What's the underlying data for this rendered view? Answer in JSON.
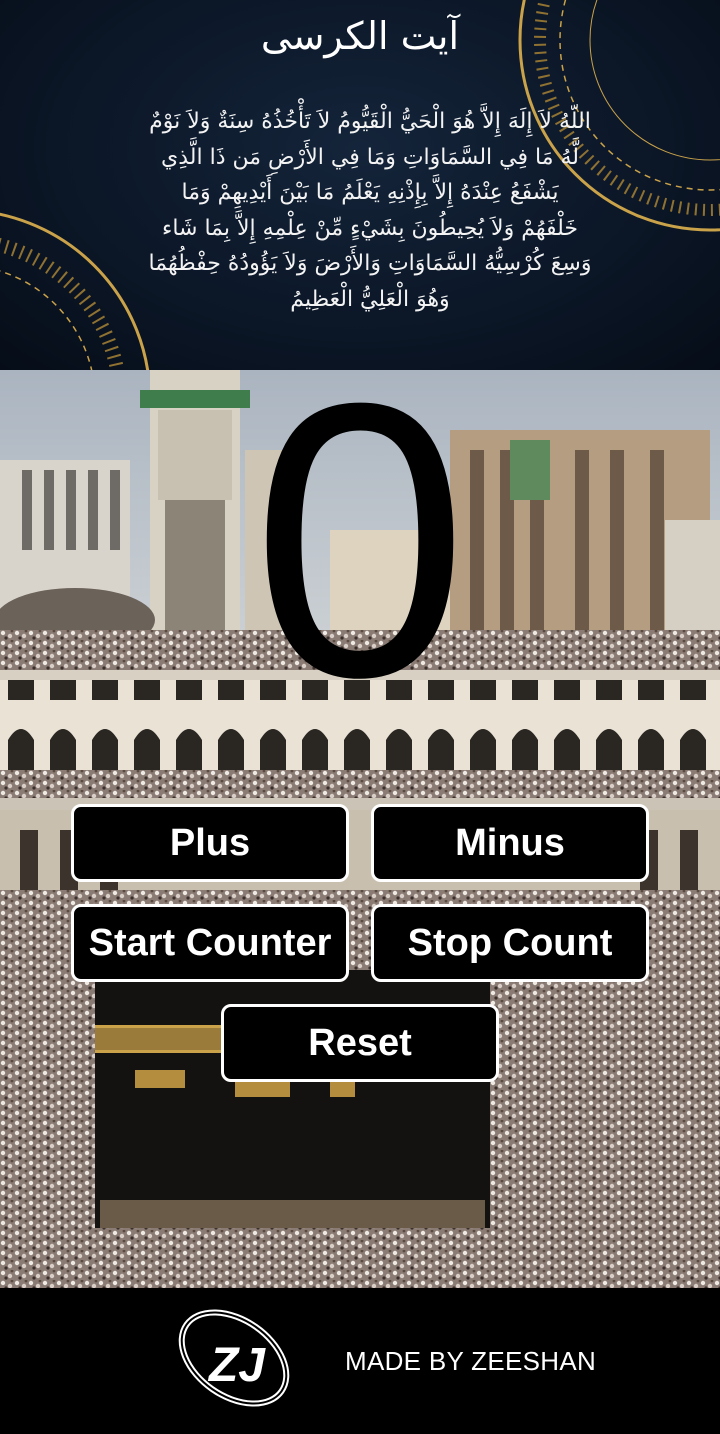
{
  "header": {
    "title": "آیت الکرسی",
    "ayat_lines": [
      "اللّهُ لاَ إِلَهَ إِلاَّ هُوَ الْحَيُّ الْقَيُّومُ لاَ تَأْخُذُهُ سِنَةٌ وَلاَ نَوْمٌ",
      "لَّهُ مَا فِي السَّمَاوَاتِ وَمَا فِي الأَرْضِ مَن ذَا الَّذِي",
      "يَشْفَعُ عِنْدَهُ إِلاَّ بِإِذْنِهِ يَعْلَمُ مَا بَيْنَ أَيْدِيهِمْ وَمَا",
      "خَلْفَهُمْ وَلاَ يُحِيطُونَ بِشَيْءٍ مِّنْ عِلْمِهِ إِلاَّ بِمَا شَاء",
      "وَسِعَ كُرْسِيُّهُ السَّمَاوَاتِ وَالأَرْضَ وَلاَ يَؤُودُهُ حِفْظُهُمَا",
      "وَهُوَ الْعَلِيُّ الْعَظِيمُ"
    ]
  },
  "counter": {
    "value": "0"
  },
  "buttons": {
    "plus": "Plus",
    "minus": "Minus",
    "start": "Start Counter",
    "stop": "Stop Count",
    "reset": "Reset"
  },
  "footer": {
    "logo_text": "ZJ",
    "made_by": "MADE BY ZEESHAN"
  },
  "colors": {
    "header_bg": "#0b1626",
    "ornament_gold": "#c9a24a",
    "button_bg": "#000000",
    "button_text": "#ffffff"
  },
  "icons": [
    "ornament-icon",
    "zj-logo-icon"
  ]
}
